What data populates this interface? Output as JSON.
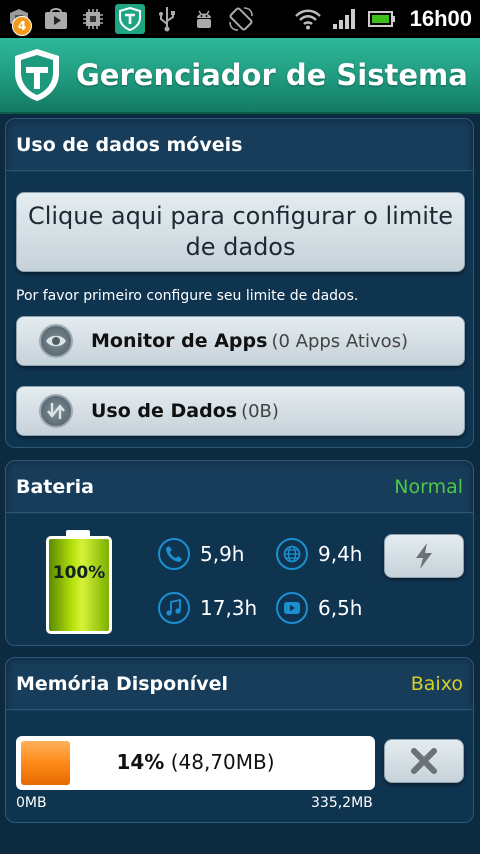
{
  "status_bar": {
    "notification_count": "4",
    "time": "16h00",
    "icons": [
      "notification-icon",
      "play-store-icon",
      "chip-icon",
      "shield-app-icon",
      "usb-icon",
      "android-debug-icon",
      "rotation-icon",
      "wifi-icon",
      "signal-icon",
      "battery-icon"
    ]
  },
  "header": {
    "title": "Gerenciador de Sistema",
    "accent": "#1fa584"
  },
  "mobile_data": {
    "title": "Uso de dados móveis",
    "configure_button": "Clique aqui para configurar o limite de dados",
    "hint": "Por favor primeiro configure seu limite de dados.",
    "app_monitor": {
      "label": "Monitor de Apps",
      "sub": "(0 Apps Ativos)"
    },
    "data_usage": {
      "label": "Uso de Dados",
      "sub": "(0B)"
    }
  },
  "battery": {
    "title": "Bateria",
    "status": "Normal",
    "status_color": "#4cc74a",
    "level": "100%",
    "stats": [
      {
        "icon": "phone-icon",
        "value": "5,9h"
      },
      {
        "icon": "globe-icon",
        "value": "9,4h"
      },
      {
        "icon": "music-icon",
        "value": "17,3h"
      },
      {
        "icon": "video-icon",
        "value": "6,5h"
      }
    ],
    "action_icon": "lightning-icon"
  },
  "memory": {
    "title": "Memória Disponível",
    "status": "Baixo",
    "status_color": "#d6d126",
    "percent": "14%",
    "fill_fraction": 0.14,
    "amount": "(48,70MB)",
    "scale_min": "0MB",
    "scale_max": "335,2MB",
    "action_icon": "close-icon"
  }
}
